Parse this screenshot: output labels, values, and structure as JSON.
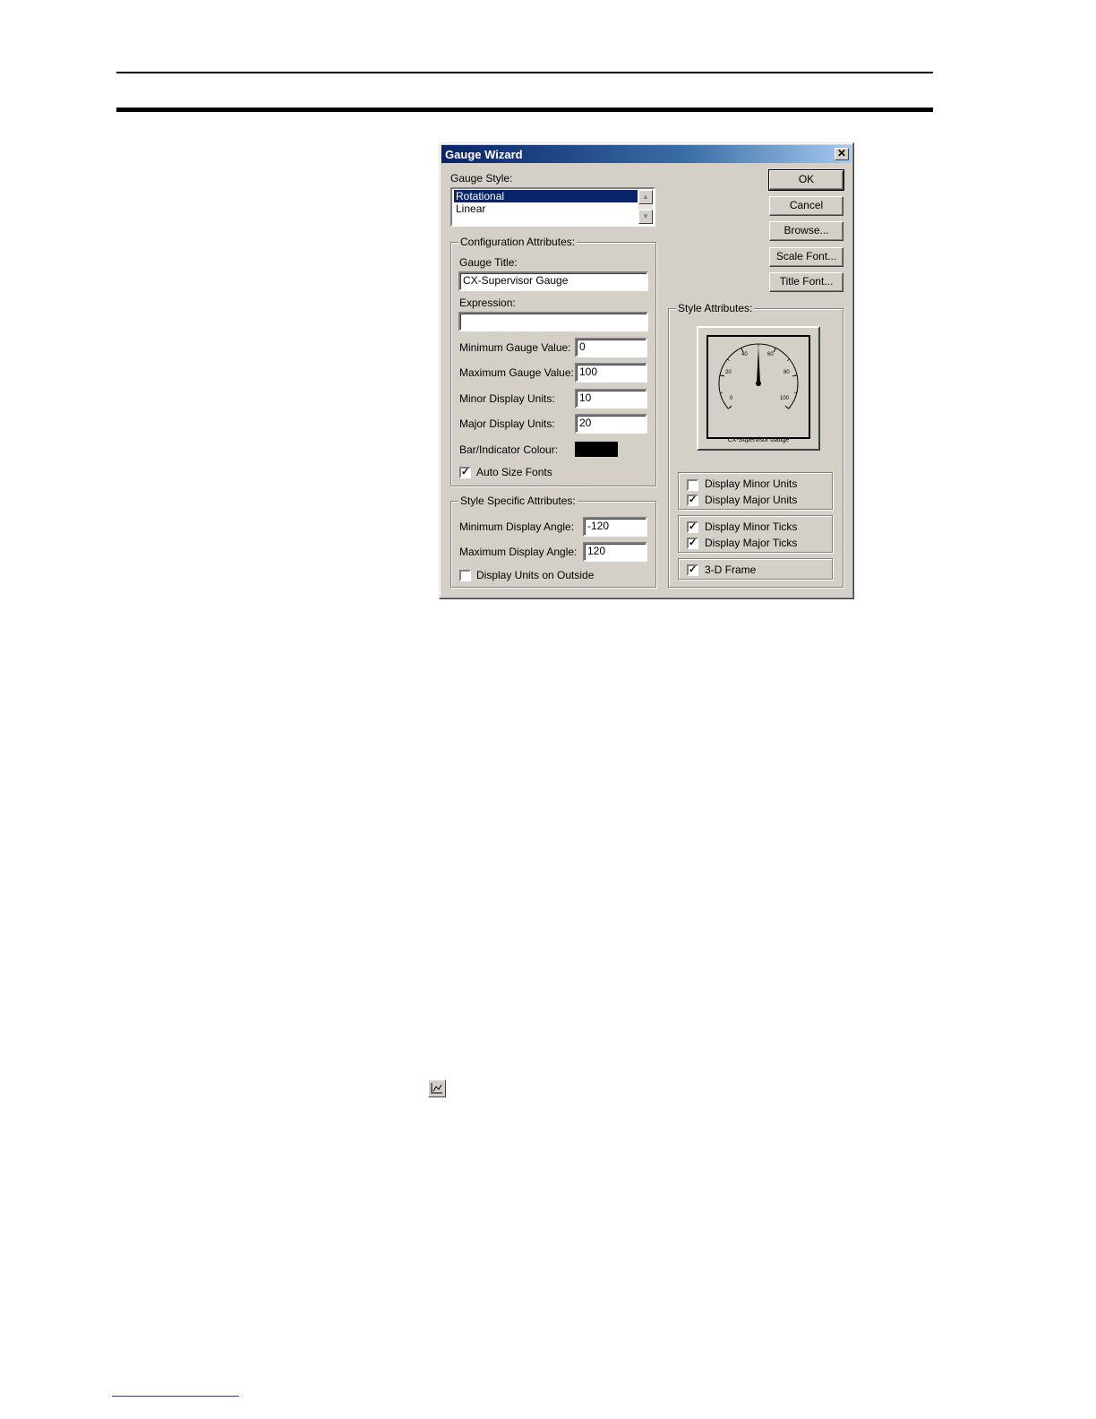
{
  "dialog": {
    "title": "Gauge Wizard",
    "close_glyph": "✕",
    "gauge_style": {
      "label": "Gauge Style:",
      "items": [
        "Rotational",
        "Linear"
      ],
      "selected": "Rotational"
    },
    "config": {
      "group_label": "Configuration Attributes:",
      "gauge_title_label": "Gauge Title:",
      "gauge_title_value": "CX-Supervisor Gauge",
      "expression_label": "Expression:",
      "expression_value": "",
      "min_value_label": "Minimum Gauge Value:",
      "min_value": "0",
      "max_value_label": "Maximum Gauge Value:",
      "max_value": "100",
      "minor_units_label": "Minor Display Units:",
      "minor_units": "10",
      "major_units_label": "Major Display Units:",
      "major_units": "20",
      "bar_colour_label": "Bar/Indicator Colour:",
      "bar_colour": "#000000",
      "auto_size_label": "Auto Size Fonts",
      "auto_size_checked": true
    },
    "style_specific": {
      "group_label": "Style Specific Attributes:",
      "min_angle_label": "Minimum Display Angle:",
      "min_angle": "-120",
      "max_angle_label": "Maximum Display Angle:",
      "max_angle": "120",
      "units_outside_label": "Display Units on Outside",
      "units_outside_checked": false
    },
    "buttons": {
      "ok": "OK",
      "cancel": "Cancel",
      "browse": "Browse...",
      "scale_font": "Scale Font...",
      "title_font": "Title Font..."
    },
    "style_attributes": {
      "group_label": "Style Attributes:",
      "preview": {
        "caption": "CX-Supervisor Gauge",
        "tick_labels": [
          "0",
          "20",
          "40",
          "60",
          "80",
          "100"
        ],
        "needle_value": 50
      },
      "display_minor_units_label": "Display Minor Units",
      "display_minor_units_checked": false,
      "display_major_units_label": "Display Major Units",
      "display_major_units_checked": true,
      "display_minor_ticks_label": "Display Minor Ticks",
      "display_minor_ticks_checked": true,
      "display_major_ticks_label": "Display Major Ticks",
      "display_major_ticks_checked": true,
      "frame_3d_label": "3-D Frame",
      "frame_3d_checked": true
    }
  },
  "toolbar_icon": "chart-tool-icon"
}
